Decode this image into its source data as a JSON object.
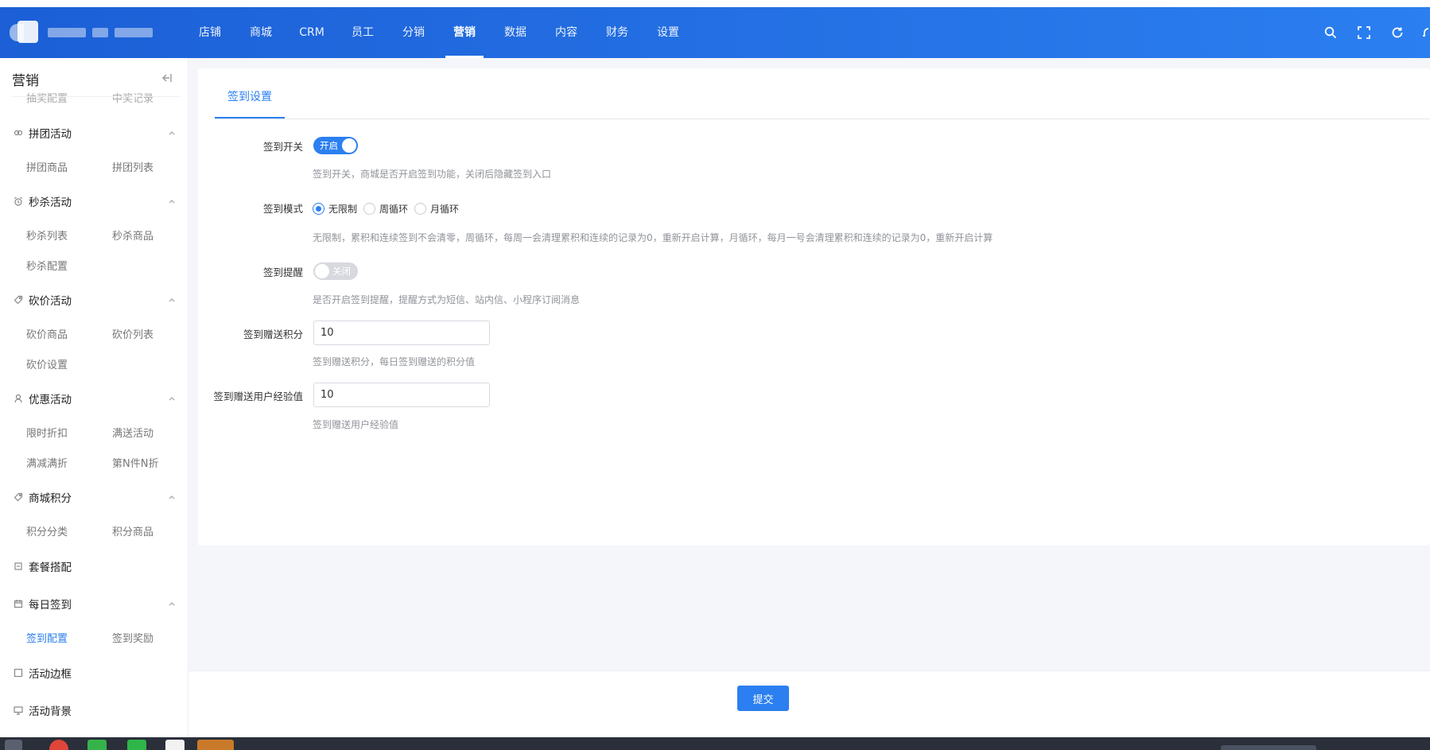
{
  "header": {
    "nav": [
      {
        "label": "店铺",
        "active": false
      },
      {
        "label": "商城",
        "active": false
      },
      {
        "label": "CRM",
        "active": false
      },
      {
        "label": "员工",
        "active": false
      },
      {
        "label": "分销",
        "active": false
      },
      {
        "label": "营销",
        "active": true
      },
      {
        "label": "数据",
        "active": false
      },
      {
        "label": "内容",
        "active": false
      },
      {
        "label": "财务",
        "active": false
      },
      {
        "label": "设置",
        "active": false
      }
    ],
    "icons": [
      "search-icon",
      "fullscreen-icon",
      "refresh-icon",
      "bell-icon"
    ]
  },
  "sidebar": {
    "title": "营销",
    "cut_items": [
      "抽奖配置",
      "中奖记录"
    ],
    "groups": [
      {
        "label": "拼团活动",
        "icon": "group-icon",
        "items": [
          "拼团商品",
          "拼团列表"
        ]
      },
      {
        "label": "秒杀活动",
        "icon": "alarm-icon",
        "items": [
          "秒杀列表",
          "秒杀商品",
          "秒杀配置"
        ]
      },
      {
        "label": "砍价活动",
        "icon": "tag-icon",
        "items": [
          "砍价商品",
          "砍价列表",
          "砍价设置"
        ]
      },
      {
        "label": "优惠活动",
        "icon": "user-icon",
        "items": [
          "限时折扣",
          "满送活动",
          "满减满折",
          "第N件N折"
        ]
      },
      {
        "label": "商城积分",
        "icon": "tag-icon",
        "items": [
          "积分分类",
          "积分商品"
        ]
      },
      {
        "label": "套餐搭配",
        "icon": "package-icon",
        "items": []
      },
      {
        "label": "每日签到",
        "icon": "calendar-icon",
        "items": [
          "签到配置",
          "签到奖励"
        ],
        "active_item": "签到配置"
      },
      {
        "label": "活动边框",
        "icon": "frame-icon",
        "items": []
      },
      {
        "label": "活动背景",
        "icon": "monitor-icon",
        "items": []
      }
    ]
  },
  "main": {
    "tab": "签到设置",
    "fields": {
      "sign_switch": {
        "label": "签到开关",
        "state_label": "开启",
        "on": true,
        "help": "签到开关，商城是否开启签到功能，关闭后隐藏签到入口"
      },
      "sign_mode": {
        "label": "签到模式",
        "options": [
          "无限制",
          "周循环",
          "月循环"
        ],
        "selected": "无限制",
        "help": "无限制，累积和连续签到不会清零，周循环，每周一会清理累积和连续的记录为0，重新开启计算，月循环，每月一号会清理累积和连续的记录为0，重新开启计算"
      },
      "sign_remind": {
        "label": "签到提醒",
        "state_label": "关闭",
        "on": false,
        "help": "是否开启签到提醒，提醒方式为短信、站内信、小程序订阅消息"
      },
      "sign_points": {
        "label": "签到赠送积分",
        "value": "10",
        "help": "签到赠送积分，每日签到赠送的积分值"
      },
      "sign_exp": {
        "label": "签到赠送用户经验值",
        "value": "10",
        "help": "签到赠送用户经验值"
      }
    },
    "submit_label": "提交"
  },
  "colors": {
    "primary": "#2b7ff0",
    "header_start": "#1c5fd6",
    "header_end": "#2b7ff0",
    "page_bg": "#f4f6f9"
  }
}
